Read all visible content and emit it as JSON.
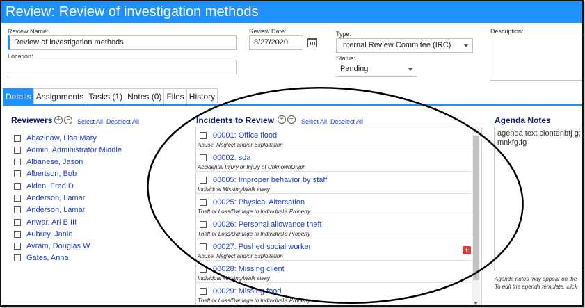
{
  "title": "Review: Review of investigation methods",
  "form": {
    "review_name_label": "Review Name:",
    "review_name_value": "Review of investigation methods",
    "location_label": "Location:",
    "location_value": "",
    "review_date_label": "Review Date:",
    "review_date_value": "8/27/2020",
    "type_label": "Type:",
    "type_value": "Internal Review Commitee (IRC)",
    "status_label": "Status:",
    "status_value": "Pending",
    "description_label": "Description:",
    "description_value": ""
  },
  "tabs": [
    {
      "label": "Details",
      "active": true
    },
    {
      "label": "Assignments"
    },
    {
      "label": "Tasks (1)"
    },
    {
      "label": "Notes (0)"
    },
    {
      "label": "Files"
    },
    {
      "label": "History"
    }
  ],
  "reviewers": {
    "title": "Reviewers",
    "select_all": "Select All",
    "deselect_all": "Deselect All",
    "items": [
      "Abazinaw, Lisa Mary",
      "Admin, Administrator Middle",
      "Albanese, Jason",
      "Albertson, Bob",
      "Alden, Fred D",
      "Anderson, Lamar",
      "Anderson, Lamar",
      "Anwar, Ari B III",
      "Aubrey, Janie",
      "Avram, Douglas W",
      "Gates, Anna"
    ]
  },
  "incidents": {
    "title": "Incidents to Review",
    "select_all": "Select All",
    "deselect_all": "Deselect All",
    "items": [
      {
        "title": "00001: Office flood",
        "category": "Abuse, Neglect and/or Exploitation"
      },
      {
        "title": "00002: sda",
        "category": "Accidental Injury or Injury of UnknownOrigin"
      },
      {
        "title": "00005: Improper behavior by staff",
        "category": "Individual Missing/Walk away"
      },
      {
        "title": "00025: Physical Altercation",
        "category": "Theft or Loss/Damage to Individual's Property"
      },
      {
        "title": "00026: Personal allowance theft",
        "category": "Theft or Loss/Damage to Individual's Property"
      },
      {
        "title": "00027: Pushed social worker",
        "category": "Abuse, Neglect and/or Exploitation"
      },
      {
        "title": "00028: Missing client",
        "category": "Individual Missing/Walk away"
      },
      {
        "title": "00029: Missing food",
        "category": "Theft or Loss/Damage to Individual's Property"
      }
    ]
  },
  "agenda": {
    "title": "Agenda Notes",
    "text": "agenda text ciontenbtj g;\nmnkfg.fg",
    "hint1": "Agenda notes may appear on the",
    "hint2": "To edit the agenda template, click"
  },
  "colors": {
    "accent": "#1e90ff",
    "link": "#1e3fcf",
    "section_title": "#0d1a6e",
    "add_icon": "#e53935"
  }
}
